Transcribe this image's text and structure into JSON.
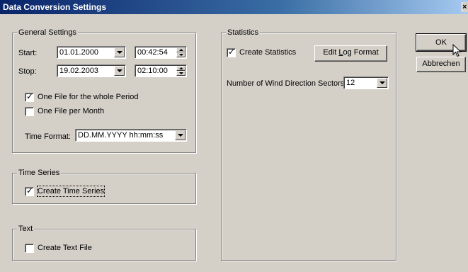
{
  "window": {
    "title": "Data Conversion Settings",
    "close_glyph": "×"
  },
  "general": {
    "legend": "General Settings",
    "start_label": "Start:",
    "start_date": "01.01.2000",
    "start_time": "00:42:54",
    "stop_label": "Stop:",
    "stop_date": "19.02.2003",
    "stop_time": "02:10:00",
    "one_file_period": "One File for the whole Period",
    "one_file_month": "One File per Month",
    "time_format_label": "Time Format:",
    "time_format": "DD.MM.YYYY hh:mm:ss"
  },
  "time_series": {
    "legend": "Time Series",
    "create_label": "Create Time Series"
  },
  "text": {
    "legend": "Text",
    "create_label": "Create Text File"
  },
  "statistics": {
    "legend": "Statistics",
    "create_label": "Create Statistics",
    "edit_log_prefix": "Edit ",
    "edit_log_underline": "L",
    "edit_log_suffix": "og Format",
    "sectors_label": "Number of Wind Direction Sectors:",
    "sectors_value": "12"
  },
  "buttons": {
    "ok": "OK",
    "cancel": "Abbrechen"
  }
}
